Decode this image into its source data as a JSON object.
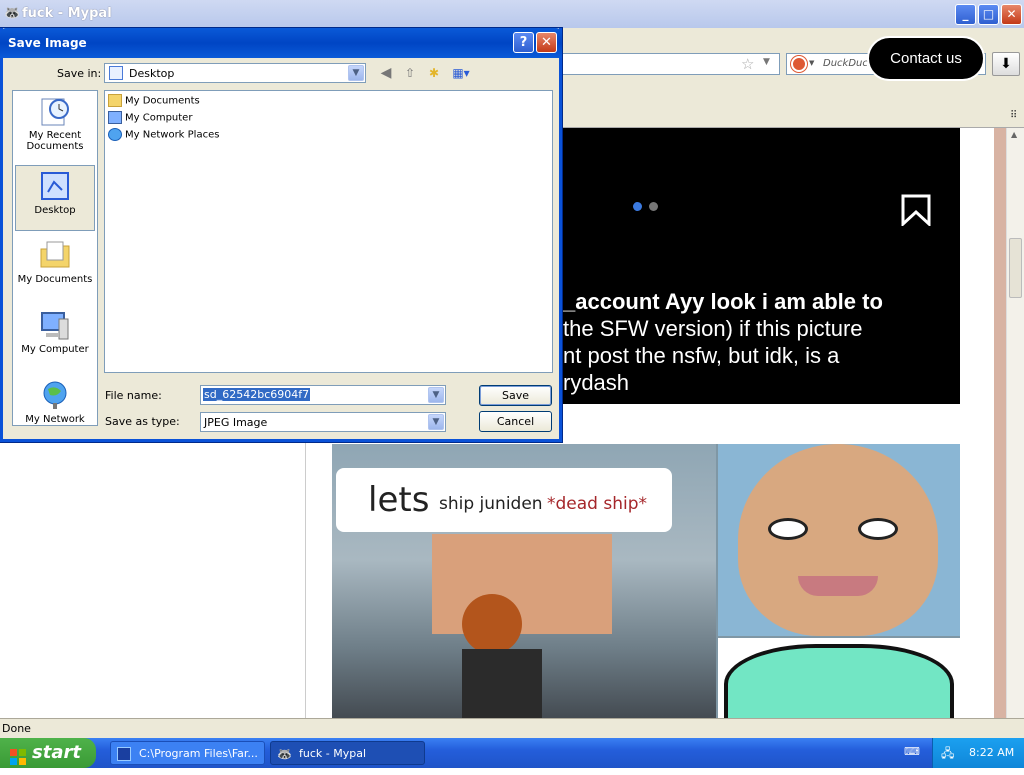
{
  "window": {
    "title": "fuck - Mypal",
    "minimize": "_",
    "maximize": "□",
    "close": "✕"
  },
  "search": {
    "placeholder": "DuckDuckGo",
    "engine_icon": "duckduckgo-icon"
  },
  "page": {
    "contact_label": "Contact us",
    "caption_lines": [
      "_account Ayy look i am able to",
      "the SFW version) if this picture",
      "nt post the nsfw, but idk, is a",
      "rydash"
    ],
    "meme_text_lets": "lets",
    "meme_text_ship": "ship juniden",
    "meme_text_dead": "*dead ship*"
  },
  "status": {
    "text": "Done"
  },
  "taskbar": {
    "start_label": "start",
    "tasks": [
      {
        "label": "C:\\Program Files\\Far...",
        "icon": "far-manager-icon"
      },
      {
        "label": "fuck - Mypal",
        "icon": "mypal-icon"
      }
    ],
    "clock": "8:22 AM"
  },
  "dialog": {
    "title": "Save Image",
    "help": "?",
    "close": "✕",
    "save_in_label": "Save in:",
    "save_in_value": "Desktop",
    "places": [
      {
        "label_line1": "My Recent",
        "label_line2": "Documents"
      },
      {
        "label_line1": "Desktop",
        "label_line2": ""
      },
      {
        "label_line1": "My Documents",
        "label_line2": ""
      },
      {
        "label_line1": "My Computer",
        "label_line2": ""
      },
      {
        "label_line1": "My Network",
        "label_line2": ""
      }
    ],
    "files": [
      "My Documents",
      "My Computer",
      "My Network Places"
    ],
    "file_name_label": "File name:",
    "file_name_value": "sd_62542bc6904f7",
    "save_type_label": "Save as type:",
    "save_type_value": "JPEG Image",
    "save_button": "Save",
    "cancel_button": "Cancel"
  }
}
